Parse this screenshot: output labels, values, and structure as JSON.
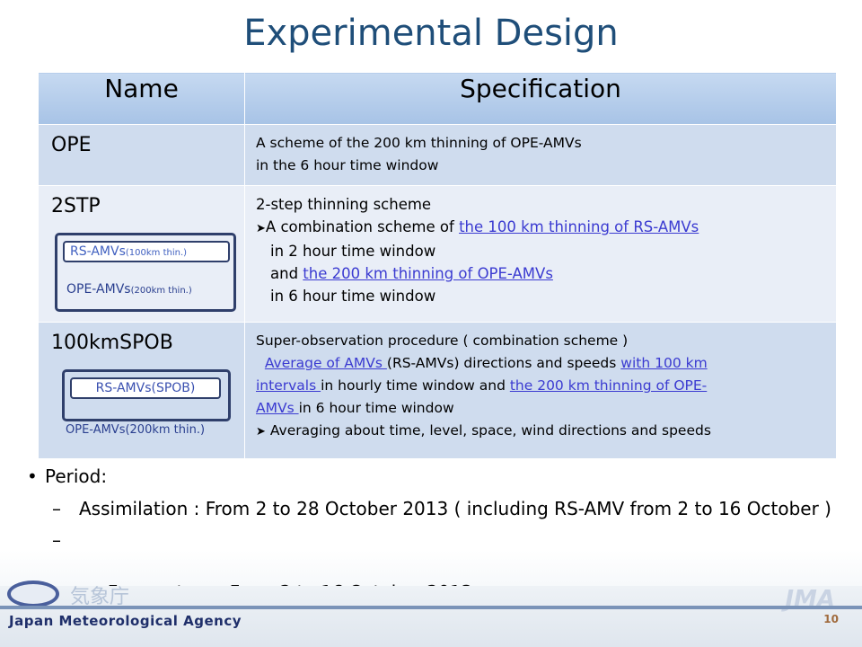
{
  "title": "Experimental Design",
  "table": {
    "headers": [
      "Name",
      "Specification"
    ],
    "rows": [
      {
        "name": "OPE",
        "spec": [
          "A scheme of the 200 km thinning of OPE-AMVs",
          "in the 6 hour time window"
        ]
      },
      {
        "name": "2STP",
        "spec_intro": "2-step thinning scheme",
        "spec_a_prefix": "A combination scheme of ",
        "spec_a_link": "the 100 km thinning of  RS-AMVs",
        "spec_b": "in 2 hour time window",
        "spec_c_prefix": "and ",
        "spec_c_link": "the 200 km thinning of OPE-AMVs",
        "spec_d": "in 6 hour time window",
        "diagram": {
          "inner_label": "RS-AMVs",
          "inner_sub": "(100km thin.)",
          "outer_label": "OPE-AMVs",
          "outer_sub": "(200km thin.)"
        }
      },
      {
        "name": "100kmSPOB",
        "spec_intro": "Super-observation procedure  ( combination scheme )",
        "l1_link": "Average of AMVs ",
        "l1_text": "(RS-AMVs) directions and speeds ",
        "l1_link2": "with 100 km",
        "l2_link": "intervals ",
        "l2_text": "in hourly time window and ",
        "l2_link2": "the 200 km thinning of OPE-",
        "l3_link": "AMVs ",
        "l3_text": " in 6 hour time window",
        "l4": "Averaging about time, level, space, wind directions and speeds",
        "diagram": {
          "inner_label": "RS-AMVs(SPOB)",
          "outer_label": "OPE-AMVs(200km thin.)"
        }
      }
    ]
  },
  "period": {
    "label": "Period:",
    "assim": "Assimilation : From 2 to 28 October 2013 ( including RS-AMV from 2 to 16 October )",
    "forecast": " Forecast      : From 2 to 16 October 2013"
  },
  "footer": {
    "agency": "Japan Meteorological Agency",
    "kanji": "気象庁",
    "logo_text": "JMA",
    "page_number": "10"
  },
  "colors": {
    "title": "#1f4e79",
    "header_bg": "#b8cde9",
    "row_dark": "#cfdcee",
    "row_light": "#e9eef7",
    "link": "#3b3bd1",
    "diagram_border": "#2f3f6b"
  }
}
